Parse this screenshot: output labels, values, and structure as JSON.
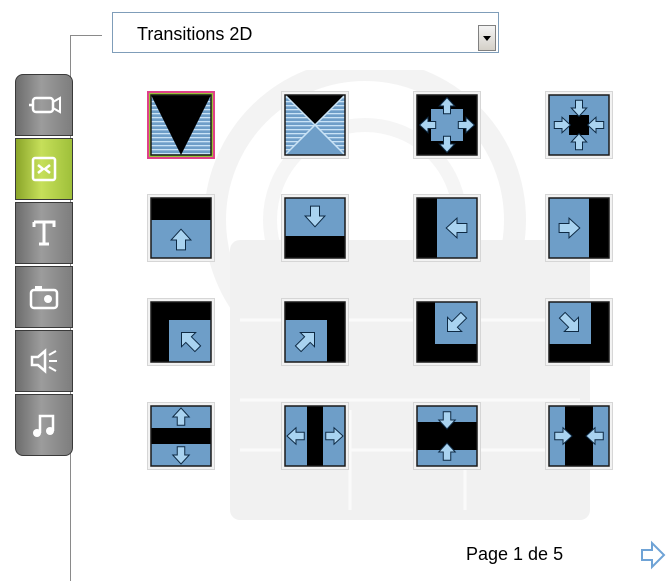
{
  "dropdown": {
    "selected": "Transitions 2D"
  },
  "tabs": [
    {
      "icon": "video-camera-icon",
      "active": false
    },
    {
      "icon": "transition-icon",
      "active": true
    },
    {
      "icon": "text-icon",
      "active": false
    },
    {
      "icon": "photo-icon",
      "active": false
    },
    {
      "icon": "sound-icon",
      "active": false
    },
    {
      "icon": "music-icon",
      "active": false
    }
  ],
  "transitions": [
    {
      "icon": "wedge-down-icon",
      "selected": true
    },
    {
      "icon": "hourglass-icon",
      "selected": false
    },
    {
      "icon": "arrows-out-icon",
      "selected": false
    },
    {
      "icon": "arrows-in-icon",
      "selected": false
    },
    {
      "icon": "push-up-icon",
      "selected": false
    },
    {
      "icon": "push-down-icon",
      "selected": false
    },
    {
      "icon": "push-left-icon",
      "selected": false
    },
    {
      "icon": "push-right-icon",
      "selected": false
    },
    {
      "icon": "diagonal-up-left-icon",
      "selected": false
    },
    {
      "icon": "diagonal-up-right-icon",
      "selected": false
    },
    {
      "icon": "diagonal-down-left-icon",
      "selected": false
    },
    {
      "icon": "diagonal-down-right-icon",
      "selected": false
    },
    {
      "icon": "split-vertical-out-icon",
      "selected": false
    },
    {
      "icon": "split-horizontal-out-icon",
      "selected": false
    },
    {
      "icon": "split-vertical-in-icon",
      "selected": false
    },
    {
      "icon": "split-horizontal-in-icon",
      "selected": false
    }
  ],
  "pagination": {
    "label": "Page 1 de 5"
  },
  "colors": {
    "tile_blue": "#6e9ec8",
    "arrow": "#a9d3f0",
    "tab_active": "#b4d04a",
    "tab_grey": "#8a8a8a",
    "selected_border": "#e0408a"
  }
}
